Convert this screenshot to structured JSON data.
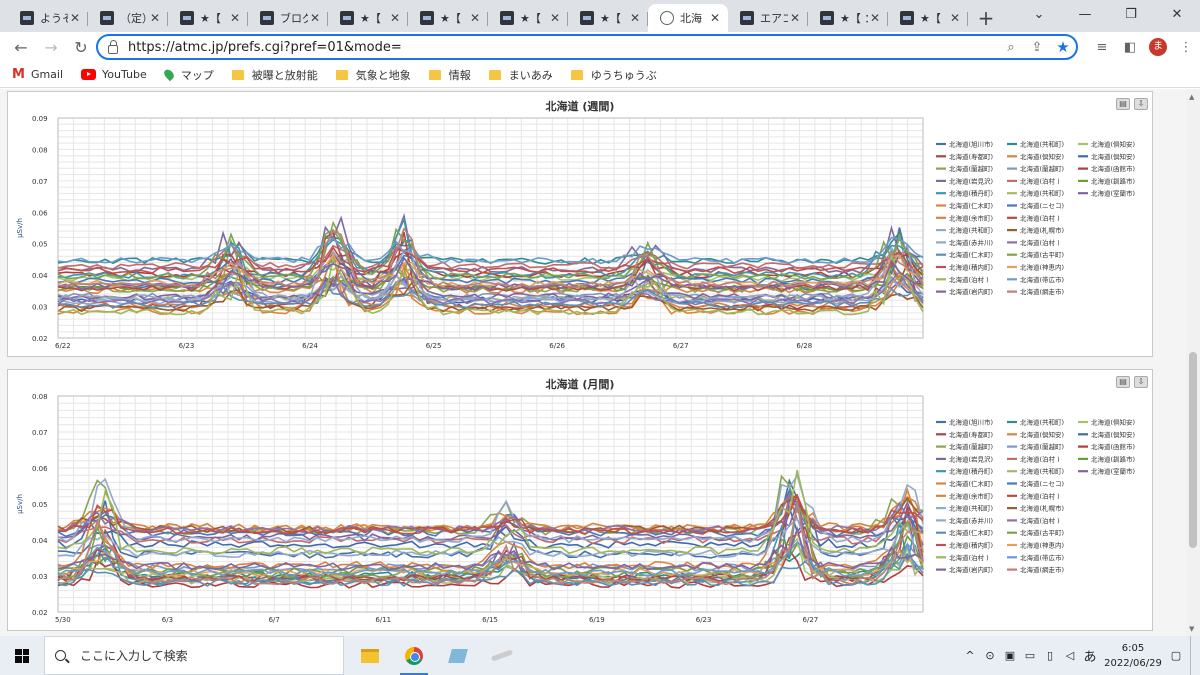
{
  "tabs": [
    {
      "label": "ようそ",
      "icon": "site-favicon"
    },
    {
      "label": "（定）",
      "icon": "site-favicon"
    },
    {
      "label": "★【",
      "icon": "site-favicon"
    },
    {
      "label": "ブログ",
      "icon": "blog-favicon"
    },
    {
      "label": "★【",
      "icon": "site-favicon"
    },
    {
      "label": "★【",
      "icon": "site-favicon"
    },
    {
      "label": "★【",
      "icon": "site-favicon"
    },
    {
      "label": "★【",
      "icon": "site-favicon"
    },
    {
      "label": "北海",
      "icon": "globe-icon",
      "active": true
    },
    {
      "label": "エアコ",
      "icon": "site-favicon"
    },
    {
      "label": "★【 ：",
      "icon": "site-favicon"
    },
    {
      "label": "★【",
      "icon": "site-favicon"
    }
  ],
  "tab_close_glyph": "✕",
  "new_tab_glyph": "+",
  "window_controls": [
    "⌄",
    "—",
    "❐",
    "✕"
  ],
  "address_bar": {
    "url": "https://atmc.jp/prefs.cgi?pref=01&mode="
  },
  "bookmarks": [
    {
      "label": "Gmail",
      "icon": "gmail-icon"
    },
    {
      "label": "YouTube",
      "icon": "youtube-icon"
    },
    {
      "label": "マップ",
      "icon": "maps-icon"
    },
    {
      "label": "被曝と放射能",
      "icon": "folder-icon"
    },
    {
      "label": "気象と地象",
      "icon": "folder-icon"
    },
    {
      "label": "情報",
      "icon": "folder-icon"
    },
    {
      "label": "まいあみ",
      "icon": "folder-icon"
    },
    {
      "label": "ゆうちゅうぶ",
      "icon": "folder-icon"
    }
  ],
  "profile_initial": "ま",
  "chart_data": [
    {
      "type": "line",
      "title": "北海道 (週間)",
      "ylabel": "µSv/h",
      "ylim": [
        0.02,
        0.09
      ],
      "yticks": [
        "0.09",
        "0.08",
        "0.07",
        "0.06",
        "0.05",
        "0.04",
        "0.03",
        "0.02"
      ],
      "xticks": [
        "6/22",
        "6/23",
        "6/24",
        "6/25",
        "6/26",
        "6/27",
        "6/28"
      ],
      "legend_position": "right",
      "grid": true
    },
    {
      "type": "line",
      "title": "北海道 (月間)",
      "ylabel": "µSv/h",
      "ylim": [
        0.02,
        0.08
      ],
      "yticks": [
        "0.08",
        "0.07",
        "0.06",
        "0.05",
        "0.04",
        "0.03",
        "0.02"
      ],
      "xticks": [
        "5/30",
        "6/3",
        "6/7",
        "6/11",
        "6/15",
        "6/19",
        "6/23",
        "6/27"
      ],
      "legend_position": "right",
      "grid": true
    }
  ],
  "legend_entries": [
    "北海道(旭川市)",
    "北海道(共和町)",
    "北海道(倶知安)",
    "北海道(寿都町)",
    "北海道(倶知安)",
    "北海道(倶知安)",
    "北海道(蘭越町)",
    "北海道(蘭越町)",
    "北海道(函館市)",
    "北海道(岩見沢)",
    "北海道(泊村 )",
    "北海道(釧路市)",
    "北海道(積丹町)",
    "北海道(共和町)",
    "北海道(室蘭市)",
    "北海道(仁木町)",
    "北海道(ニセコ)",
    "北海道(余市町)",
    "北海道(泊村 )",
    "北海道(共和町)",
    "北海道(札幌市)",
    "北海道(赤井川)",
    "北海道(泊村 )",
    "北海道(仁木町)",
    "北海道(古平町)",
    "北海道(積内町)",
    "北海道(神恵内)",
    "北海道(泊村 )",
    "北海道(帯広市)",
    "北海道(岩内町)",
    "北海道(網走市)"
  ],
  "legend_colors": [
    "#4572a7",
    "#2f8c8c",
    "#a4c36c",
    "#aa4643",
    "#db843d",
    "#3d6ab0",
    "#89a54e",
    "#7d95c9",
    "#b33c3c",
    "#80699b",
    "#c46a6a",
    "#6e9c3a",
    "#3d96ae",
    "#a8b86a",
    "#8064a2",
    "#db843d",
    "#4a78b8",
    "#d9843d",
    "#b24a46",
    "#93a9cf",
    "#a05a2c",
    "#92a8cd",
    "#8e6fb0",
    "#5b8fb8",
    "#7aa44e",
    "#c0504d",
    "#e0a060",
    "#9cb85a",
    "#6a9ad0",
    "#8064a2",
    "#c0807a"
  ],
  "taskbar": {
    "search_placeholder": "ここに入力して検索"
  },
  "tray": {
    "time": "6:05",
    "date": "2022/06/29",
    "ime": "あ"
  }
}
